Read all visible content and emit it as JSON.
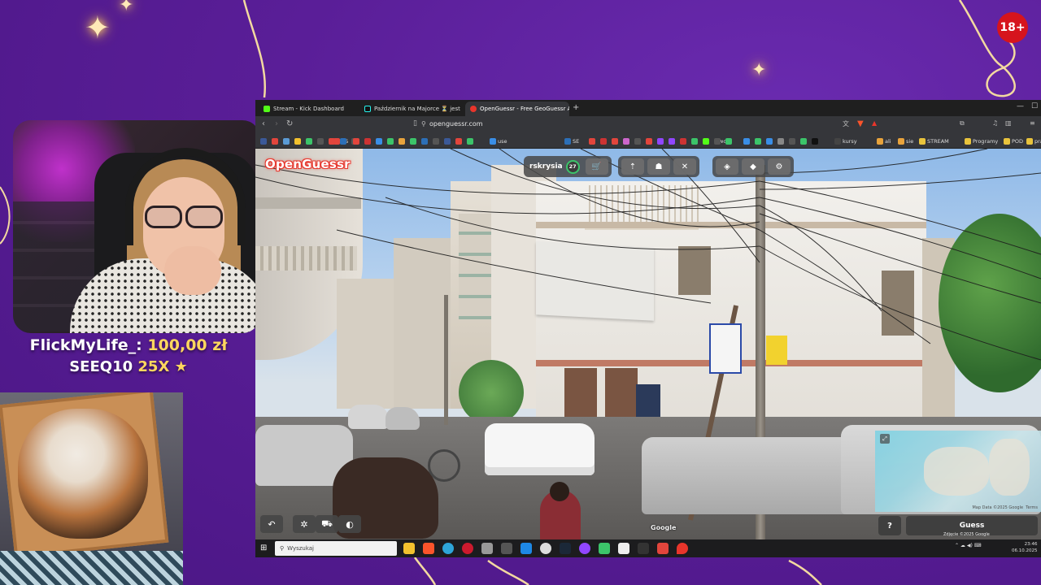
{
  "overlay": {
    "age_badge": "18+",
    "donation": {
      "name": "FlickMyLife_:",
      "amount": "100,00 zł",
      "code": "SEEQ10",
      "multiplier": "25X",
      "icon": "star-icon"
    }
  },
  "browser": {
    "tabs": [
      {
        "label": "Stream - Kick Dashboard",
        "icon": "kick-icon",
        "color": "#53fc18"
      },
      {
        "label": "Październik na Majorce ⏳ jest to nas",
        "icon": "tiktok-icon",
        "color": "#111111"
      },
      {
        "label": "OpenGuessr - Free GeoGuessr A",
        "icon": "openguessr-icon",
        "color": "#e8352b"
      }
    ],
    "new_tab": "+",
    "url": "openguessr.com",
    "bookmarks": [
      "ES",
      "use",
      "SE",
      "work",
      "kursy",
      "ali",
      "sie",
      "STREAM",
      "Programy",
      "POD",
      "praca"
    ]
  },
  "game": {
    "logo": "OpenGuessr",
    "username": "rskrysia",
    "level": "27",
    "buttons": {
      "shop": "cart-icon",
      "settings_group": [
        "pin-icon",
        "ghost-icon",
        "cross-icon"
      ],
      "layers": [
        "layers-icon",
        "stack-icon",
        "gear-icon"
      ]
    },
    "google_watermark": "Google",
    "map_credit": "Map Data ©2025 Google",
    "map_terms": "Terms",
    "street_credit": "Zdjęcie ©2025 Google",
    "guess_label": "Guess",
    "help_label": "?"
  },
  "taskbar": {
    "search_placeholder": "Wyszukaj",
    "time": "23:46",
    "date": "06.10.2025"
  }
}
